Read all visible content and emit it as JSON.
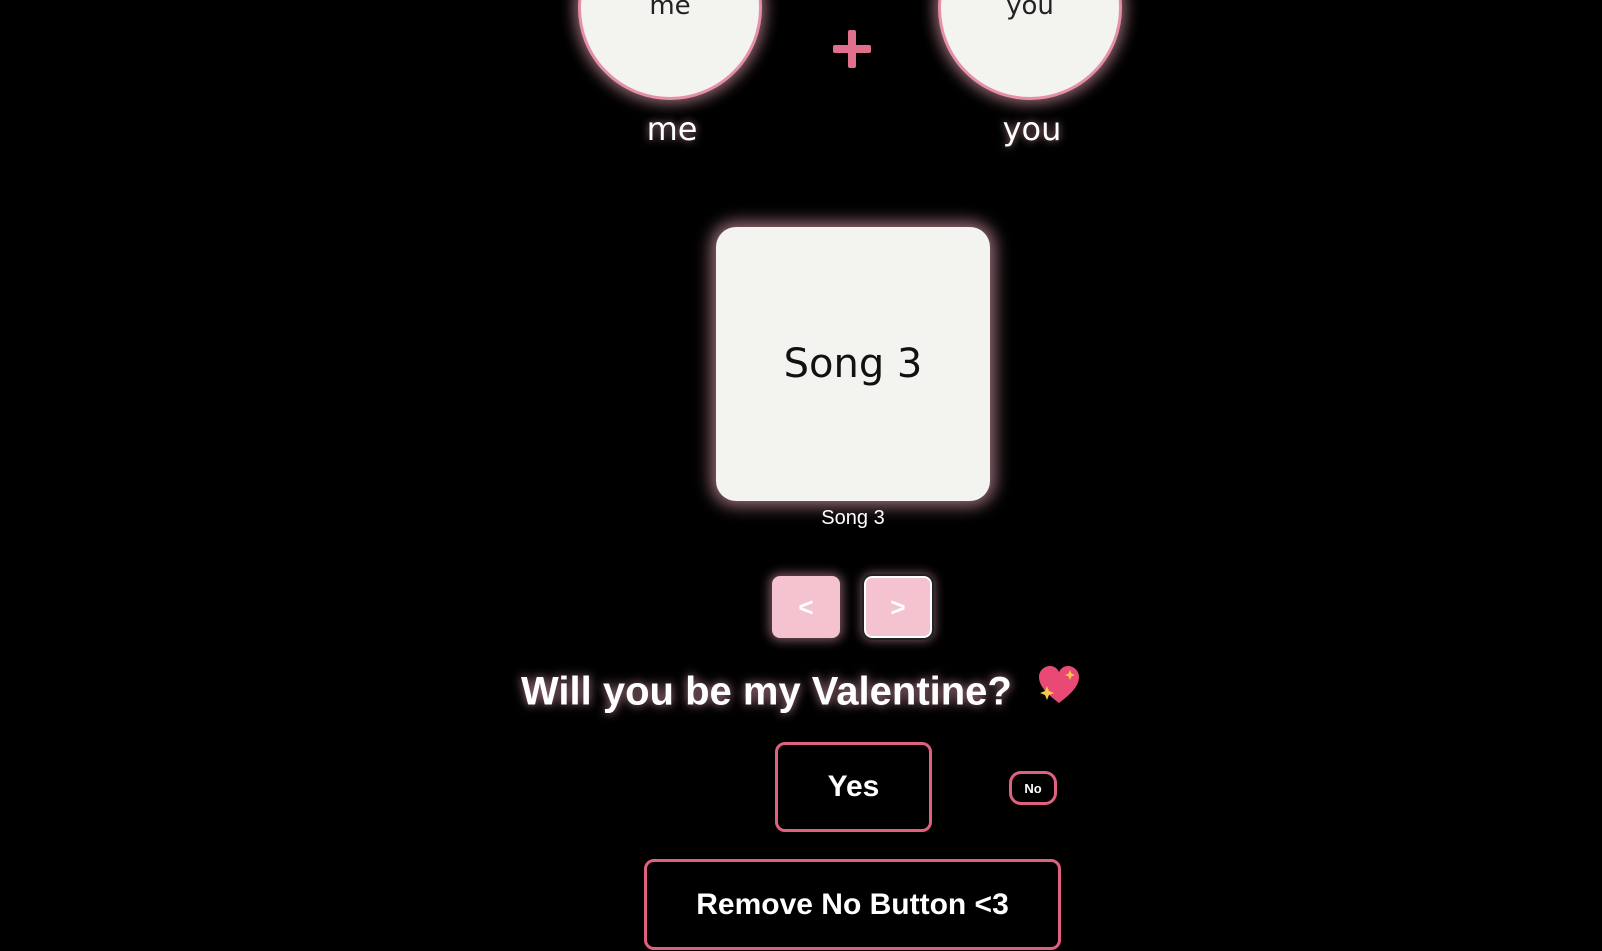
{
  "couple": {
    "left": {
      "avatar_text": "me",
      "name": "me"
    },
    "right": {
      "avatar_text": "you",
      "name": "you"
    },
    "joiner_icon": "plus-icon"
  },
  "song": {
    "card_title": "Song 3",
    "caption": "Song 3"
  },
  "player": {
    "prev_label": "<",
    "next_label": ">"
  },
  "proposal": {
    "question": "Will you be my Valentine?",
    "emoji_icon": "sparkling-heart-icon",
    "yes_label": "Yes",
    "no_label": "No",
    "remove_no_label": "Remove No Button <3"
  },
  "colors": {
    "background": "#000000",
    "accent_pink": "#e0617f",
    "soft_pink": "#f5c2cf",
    "card": "#f3f3ef"
  }
}
